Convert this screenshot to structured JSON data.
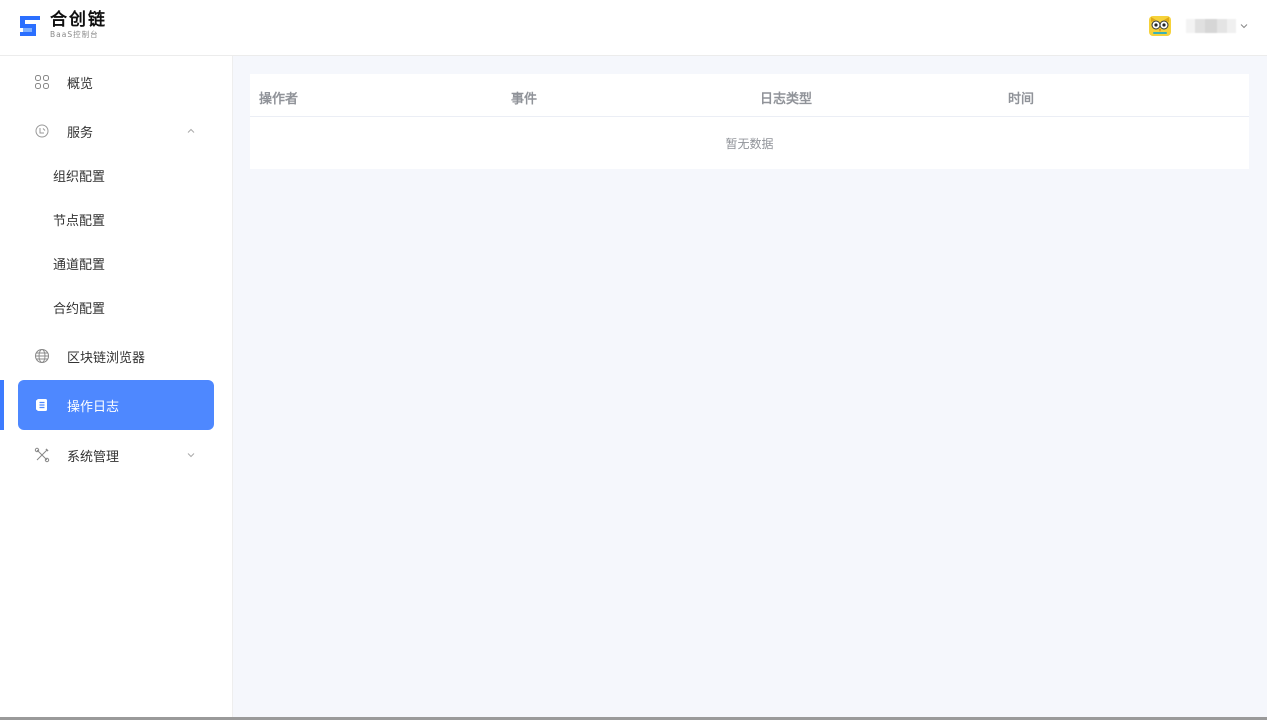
{
  "brand": {
    "title": "合创链",
    "subtitle": "BaaS控制台",
    "primary_color": "#2b6fff",
    "accent_color": "#4e88ff"
  },
  "header": {
    "avatar_icon": "owl-avatar-icon",
    "dropdown_icon": "chevron-down-icon"
  },
  "sidebar": {
    "items": [
      {
        "label": "概览",
        "icon": "grid-icon"
      },
      {
        "label": "服务",
        "icon": "service-icon",
        "expanded": true
      },
      {
        "label": "区块链浏览器",
        "icon": "globe-icon"
      },
      {
        "label": "操作日志",
        "icon": "log-icon",
        "active": true
      },
      {
        "label": "系统管理",
        "icon": "tools-icon",
        "expanded": false
      }
    ],
    "service_children": [
      "组织配置",
      "节点配置",
      "通道配置",
      "合约配置"
    ]
  },
  "table": {
    "columns": [
      "操作者",
      "事件",
      "日志类型",
      "时间"
    ],
    "empty_text": "暂无数据"
  }
}
